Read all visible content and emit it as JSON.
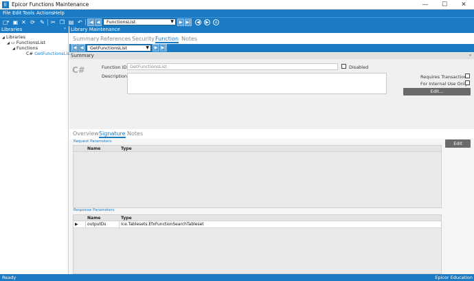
{
  "window": {
    "title": "Epicor Functions Maintenance",
    "icon": "E",
    "minimize": "—",
    "maximize": "☐",
    "close": "✕"
  },
  "menu": [
    "File",
    "Edit",
    "Tools",
    "Actions",
    "Help"
  ],
  "toolbar": {
    "icons": [
      "new-icon",
      "save-icon",
      "delete-icon",
      "refresh-icon",
      "clear-icon",
      "cut-icon",
      "copy-icon",
      "paste-icon",
      "undo-icon"
    ],
    "record_combo": "FunctionsList",
    "nav_icons": [
      "back-icon",
      "forward-icon",
      "home-icon"
    ]
  },
  "left_panel": {
    "header": "Libraries",
    "pin": "ᵖ",
    "tree": [
      {
        "label": "Libraries",
        "level": 0,
        "arrow": "◢"
      },
      {
        "label": "FunctionsList",
        "level": 1,
        "arrow": "◢"
      },
      {
        "label": "Functions",
        "level": 2,
        "arrow": "◢"
      },
      {
        "label": "GetFunctionsList",
        "level": 3,
        "prefix": "C#",
        "selected": true
      }
    ]
  },
  "main": {
    "header": "Library Maintenance",
    "tabs": [
      "Summary",
      "References",
      "Security",
      "Function",
      "Notes"
    ],
    "active_tab": "Function",
    "record_combo": "GetFunctionsList",
    "summary_label": "Summary",
    "summary_pin": "ᵖ",
    "form": {
      "lang_badge": "C#",
      "function_id_label": "Function ID:",
      "function_id_value": "GetFunctionsList",
      "disabled_label": "Disabled",
      "description_label": "Description:",
      "requires_transaction_label": "Requires Transaction:",
      "internal_use_label": "For Internal Use Only:",
      "edit_button": "Edit..."
    },
    "subtabs": [
      "Overview",
      "Signature",
      "Notes"
    ],
    "active_subtab": "Signature",
    "signature": {
      "request_label": "Request Parameters",
      "request_columns": [
        "Name",
        "Type"
      ],
      "request_rows": [],
      "response_label": "Response Parameters",
      "response_columns": [
        "Name",
        "Type"
      ],
      "response_rows": [
        {
          "name": "outputDs",
          "type": "Ice.Tablesets.EfxFunctionSearchTableset"
        }
      ],
      "edit_button": "Edit"
    }
  },
  "status": {
    "left": "Ready",
    "right": "Epicor Education"
  },
  "colors": {
    "accent": "#1a7ac4",
    "toolbar": "#1a7ac4",
    "gray_button": "#6a6a6a"
  }
}
